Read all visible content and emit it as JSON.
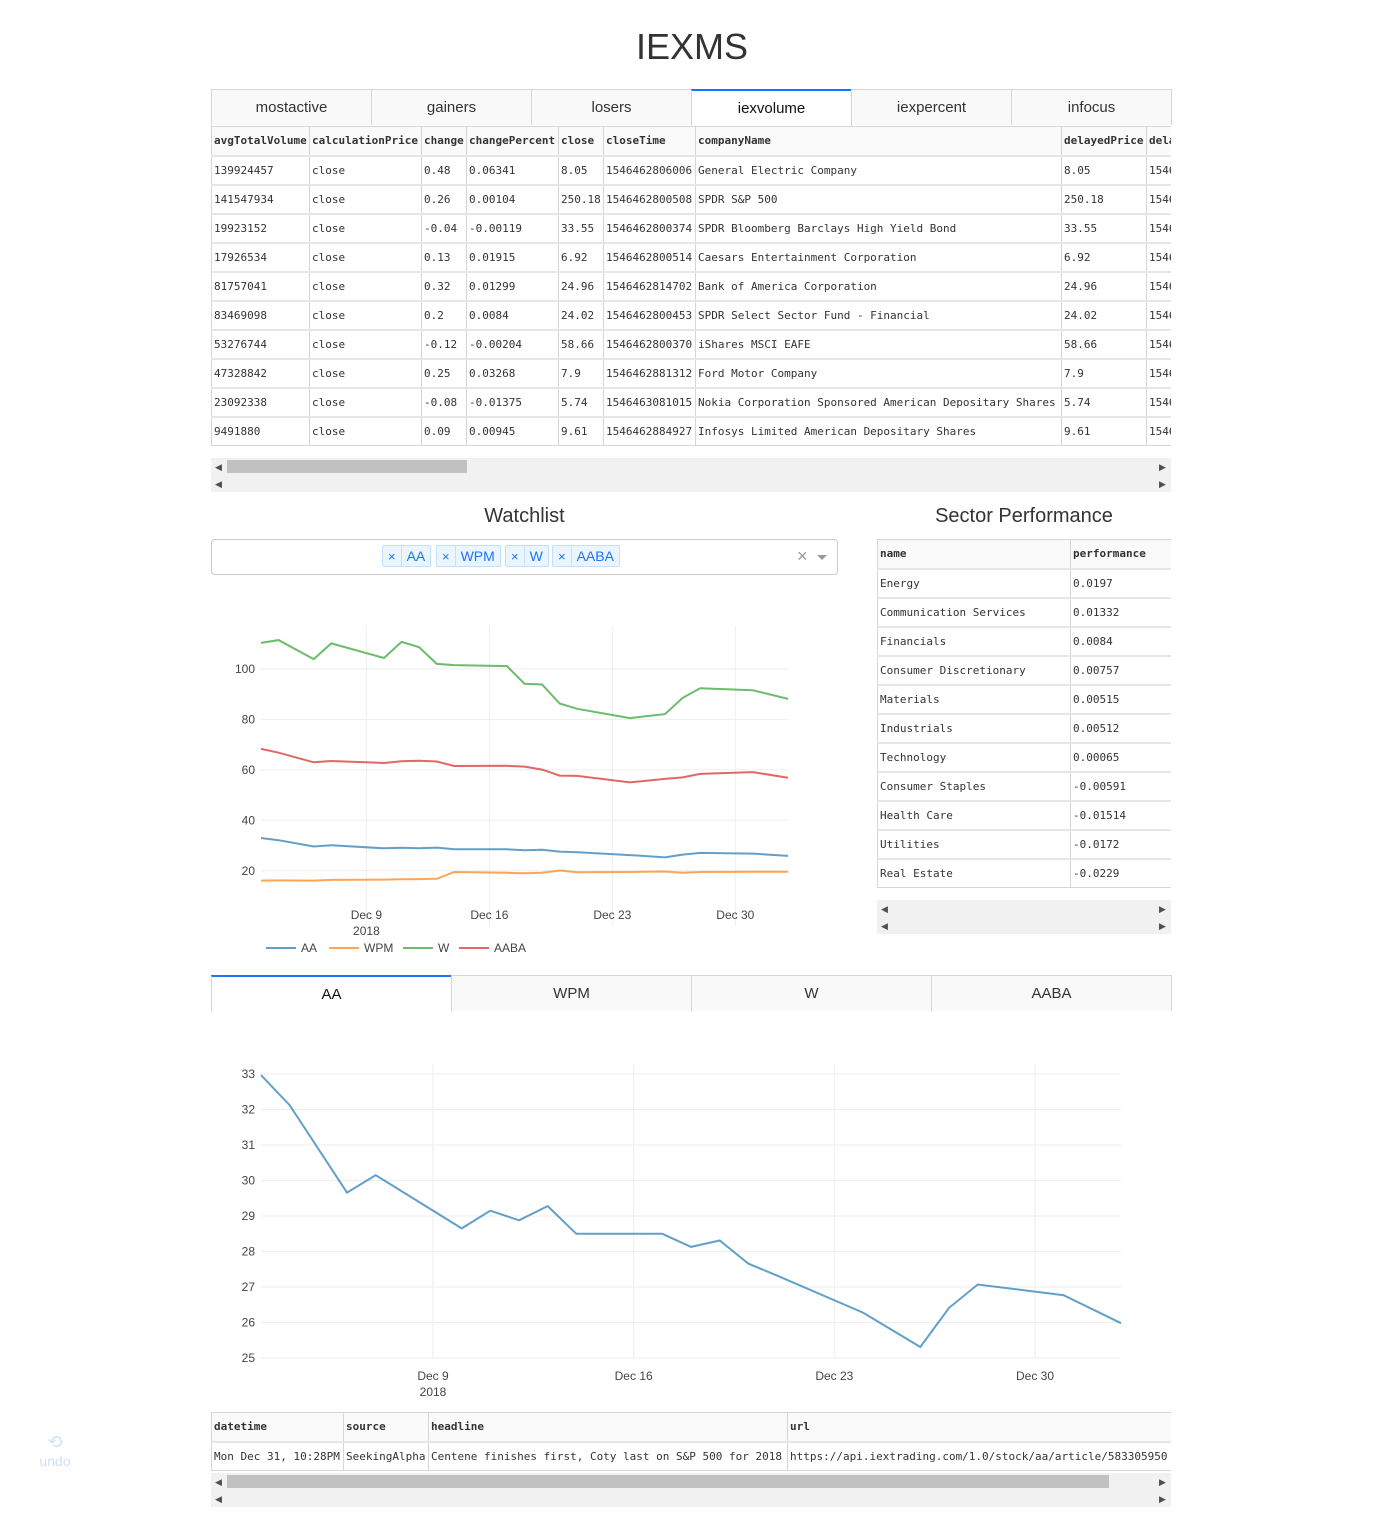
{
  "app_title": "IEXMS",
  "market_tabs": [
    "mostactive",
    "gainers",
    "losers",
    "iexvolume",
    "iexpercent",
    "infocus"
  ],
  "market_table": {
    "columns": [
      "avgTotalVolume",
      "calculationPrice",
      "change",
      "changePercent",
      "close",
      "closeTime",
      "companyName",
      "delayedPrice",
      "dela"
    ],
    "rows": [
      [
        "139924457",
        "close",
        "0.48",
        "0.06341",
        "8.05",
        "1546462806006",
        "General Electric Company",
        "8.05",
        "1546"
      ],
      [
        "141547934",
        "close",
        "0.26",
        "0.00104",
        "250.18",
        "1546462800508",
        "SPDR S&P 500",
        "250.18",
        "1546"
      ],
      [
        "19923152",
        "close",
        "-0.04",
        "-0.00119",
        "33.55",
        "1546462800374",
        "SPDR Bloomberg Barclays High Yield Bond",
        "33.55",
        "1546"
      ],
      [
        "17926534",
        "close",
        "0.13",
        "0.01915",
        "6.92",
        "1546462800514",
        "Caesars Entertainment Corporation",
        "6.92",
        "1546"
      ],
      [
        "81757041",
        "close",
        "0.32",
        "0.01299",
        "24.96",
        "1546462814702",
        "Bank of America Corporation",
        "24.96",
        "1546"
      ],
      [
        "83469098",
        "close",
        "0.2",
        "0.0084",
        "24.02",
        "1546462800453",
        "SPDR Select Sector Fund - Financial",
        "24.02",
        "1546"
      ],
      [
        "53276744",
        "close",
        "-0.12",
        "-0.00204",
        "58.66",
        "1546462800370",
        "iShares MSCI EAFE",
        "58.66",
        "1546"
      ],
      [
        "47328842",
        "close",
        "0.25",
        "0.03268",
        "7.9",
        "1546462881312",
        "Ford Motor Company",
        "7.9",
        "1546"
      ],
      [
        "23092338",
        "close",
        "-0.08",
        "-0.01375",
        "5.74",
        "1546463081015",
        "Nokia Corporation Sponsored American Depositary Shares",
        "5.74",
        "1546"
      ],
      [
        "9491880",
        "close",
        "0.09",
        "0.00945",
        "9.61",
        "1546462884927",
        "Infosys Limited American Depositary Shares",
        "9.61",
        "1546"
      ]
    ]
  },
  "watchlist": {
    "title": "Watchlist",
    "chips": [
      "AA",
      "WPM",
      "W",
      "AABA"
    ],
    "clear_glyph": "×",
    "chip_remove_glyph": "×"
  },
  "sector": {
    "title": "Sector Performance",
    "columns": [
      "name",
      "performance"
    ],
    "rows": [
      [
        "Energy",
        "0.0197"
      ],
      [
        "Communication Services",
        "0.01332"
      ],
      [
        "Financials",
        "0.0084"
      ],
      [
        "Consumer Discretionary",
        "0.00757"
      ],
      [
        "Materials",
        "0.00515"
      ],
      [
        "Industrials",
        "0.00512"
      ],
      [
        "Technology",
        "0.00065"
      ],
      [
        "Consumer Staples",
        "-0.00591"
      ],
      [
        "Health Care",
        "-0.01514"
      ],
      [
        "Utilities",
        "-0.0172"
      ],
      [
        "Real Estate",
        "-0.0229"
      ]
    ]
  },
  "stock_tabs": [
    "AA",
    "WPM",
    "W",
    "AABA"
  ],
  "news_table": {
    "columns": [
      "datetime",
      "source",
      "headline",
      "url"
    ],
    "rows": [
      [
        "Mon Dec 31, 10:28PM",
        "SeekingAlpha",
        "Centene finishes first, Coty last on S&P 500 for 2018",
        "https://api.iextrading.com/1.0/stock/aa/article/583305950"
      ]
    ]
  },
  "undo_label": "undo",
  "colors": {
    "AA": "#1f77b4",
    "WPM": "#ff7f0e",
    "W": "#2ca02c",
    "AABA": "#d62728",
    "accent": "#1975fa"
  },
  "chart_data": [
    {
      "type": "line",
      "title": "",
      "x_ticks": [
        "Dec 9",
        "Dec 16",
        "Dec 23",
        "Dec 30"
      ],
      "x_tick_year": "2018",
      "y_ticks": [
        20,
        40,
        60,
        80,
        100
      ],
      "ylim": [
        10,
        117
      ],
      "xlim": [
        "2018-12-03",
        "2019-01-02"
      ],
      "legend": "bottom-left",
      "grid": true,
      "x": [
        "2018-12-03",
        "2018-12-04",
        "2018-12-06",
        "2018-12-07",
        "2018-12-10",
        "2018-12-11",
        "2018-12-12",
        "2018-12-13",
        "2018-12-14",
        "2018-12-17",
        "2018-12-18",
        "2018-12-19",
        "2018-12-20",
        "2018-12-21",
        "2018-12-24",
        "2018-12-26",
        "2018-12-27",
        "2018-12-28",
        "2018-12-31",
        "2019-01-02"
      ],
      "series": [
        {
          "name": "AA",
          "values": [
            33.0,
            32.1,
            29.6,
            30.1,
            28.9,
            29.1,
            28.9,
            29.2,
            28.5,
            28.5,
            28.1,
            28.3,
            27.6,
            27.3,
            26.2,
            25.3,
            26.4,
            27.1,
            26.8,
            25.9
          ]
        },
        {
          "name": "WPM",
          "values": [
            16.1,
            16.2,
            16.1,
            16.4,
            16.5,
            16.6,
            16.7,
            16.8,
            19.5,
            19.2,
            19.0,
            19.2,
            20.1,
            19.4,
            19.5,
            19.7,
            19.2,
            19.5,
            19.6,
            19.6
          ]
        },
        {
          "name": "W",
          "values": [
            110.3,
            111.4,
            103.9,
            110.1,
            104.3,
            110.7,
            108.6,
            102.0,
            101.5,
            101.1,
            94.1,
            93.8,
            86.3,
            84.2,
            80.5,
            82.1,
            88.5,
            92.3,
            91.5,
            88.1
          ]
        },
        {
          "name": "AABA",
          "values": [
            68.3,
            66.8,
            63.0,
            63.5,
            62.7,
            63.4,
            63.6,
            63.3,
            61.5,
            61.6,
            61.3,
            60.1,
            57.7,
            57.6,
            55.0,
            56.4,
            57.0,
            58.4,
            59.1,
            56.9
          ]
        }
      ]
    },
    {
      "type": "line",
      "title": "",
      "x_ticks": [
        "Dec 9",
        "Dec 16",
        "Dec 23",
        "Dec 30"
      ],
      "x_tick_year": "2018",
      "y_ticks": [
        25,
        26,
        27,
        28,
        29,
        30,
        31,
        32,
        33
      ],
      "ylim": [
        25,
        33
      ],
      "xlim": [
        "2018-12-03",
        "2019-01-02"
      ],
      "grid": true,
      "x": [
        "2018-12-03",
        "2018-12-04",
        "2018-12-06",
        "2018-12-07",
        "2018-12-10",
        "2018-12-11",
        "2018-12-12",
        "2018-12-13",
        "2018-12-14",
        "2018-12-17",
        "2018-12-18",
        "2018-12-19",
        "2018-12-20",
        "2018-12-21",
        "2018-12-24",
        "2018-12-26",
        "2018-12-27",
        "2018-12-28",
        "2018-12-31",
        "2019-01-02"
      ],
      "series": [
        {
          "name": "AA",
          "values": [
            32.97,
            32.12,
            29.66,
            30.15,
            28.65,
            29.15,
            28.88,
            29.28,
            28.5,
            28.5,
            28.13,
            28.31,
            27.66,
            27.32,
            26.28,
            25.31,
            26.41,
            27.07,
            26.77,
            25.98
          ]
        }
      ]
    }
  ]
}
